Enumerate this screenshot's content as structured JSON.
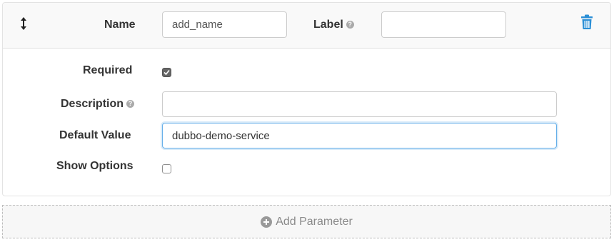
{
  "param": {
    "name_label": "Name",
    "name_value": "add_name",
    "label_label": "Label",
    "label_value": "",
    "required_label": "Required",
    "required_checked": true,
    "description_label": "Description",
    "description_value": "",
    "default_label": "Default Value",
    "default_value": "dubbo-demo-service",
    "show_options_label": "Show Options",
    "show_options_checked": false,
    "help_icon": "?"
  },
  "actions": {
    "add_parameter_label": "Add Parameter"
  },
  "colors": {
    "trash": "#2b8fd6",
    "focus_border": "#66afe9",
    "header_bg": "#f9f9f9"
  },
  "icons": {
    "drag": "drag-vertical-icon",
    "delete": "trash-icon",
    "help": "question-circle-icon",
    "add": "plus-circle-icon"
  }
}
